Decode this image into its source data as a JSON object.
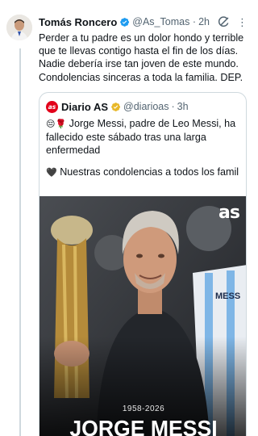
{
  "tweet": {
    "display_name": "Tomás Roncero",
    "handle": "@As_Tomas...",
    "separator": "·",
    "time": "2h",
    "more": "⋮",
    "text": "Perder a tu padre es un dolor hondo y terrible que te llevas contigo hasta el fin de los días. Nadie debería irse tan joven de este mundo. Condolencias sinceras a toda la familia. DEP."
  },
  "quote": {
    "logo_text": "as",
    "name": "Diario AS",
    "handle": "@diarioas",
    "separator": "·",
    "time": "3h",
    "emoji_sad": "😔",
    "emoji_rose": "🌹",
    "text": "Jorge Messi, padre de Leo Messi, ha fallecido este sábado tras una larga enfermedad",
    "emoji_heart": "🖤",
    "text2": "Nuestras condolencias a todos los famil..."
  },
  "media": {
    "logo": "as",
    "jersey_text": "MESS",
    "years": "1958-2026",
    "name": "JORGE MESSI"
  },
  "colors": {
    "verified": "#1d9bf0",
    "verified_gold": "#e8b829",
    "brand_red": "#e2001a",
    "secondary_text": "#536471",
    "border": "#cfd9de"
  },
  "icons": {
    "verified": "verified-badge-icon",
    "grok": "grok-icon",
    "more": "more-icon"
  }
}
